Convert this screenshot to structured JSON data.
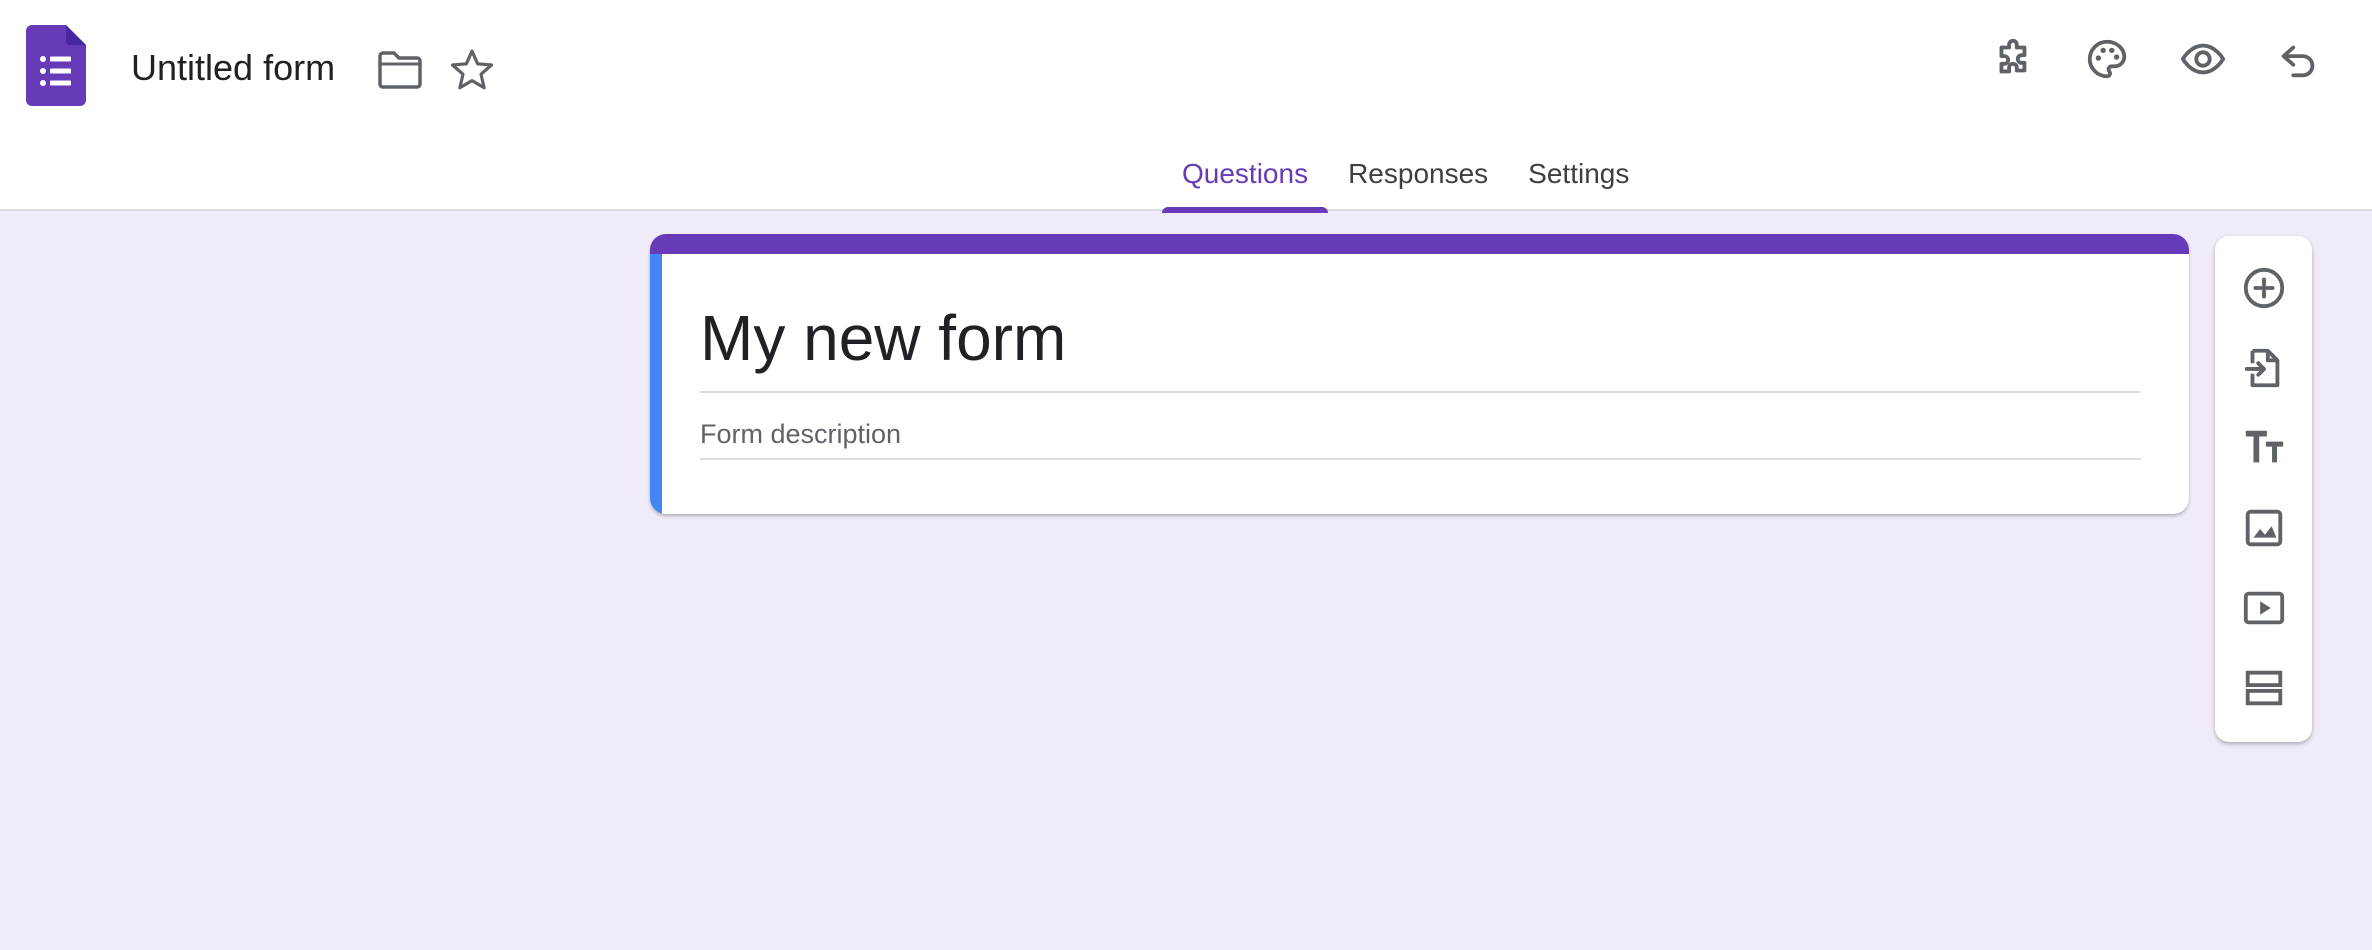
{
  "header": {
    "doc_title": "Untitled form",
    "icons": [
      "forms-logo-icon",
      "folder-icon",
      "star-icon",
      "addons-puzzle-icon",
      "palette-icon",
      "preview-eye-icon",
      "undo-icon"
    ]
  },
  "tabs": [
    {
      "label": "Questions",
      "active": true
    },
    {
      "label": "Responses",
      "active": false
    },
    {
      "label": "Settings",
      "active": false
    }
  ],
  "form": {
    "title": "My new form",
    "description_placeholder": "Form description"
  },
  "toolbar": {
    "items": [
      "add-question-icon",
      "import-questions-icon",
      "add-title-description-icon",
      "add-image-icon",
      "add-video-icon",
      "add-section-icon"
    ]
  },
  "colors": {
    "accent": "#673ab7",
    "card_side": "#4285f4",
    "background": "#f0ebf8",
    "icon": "#5f6368"
  }
}
